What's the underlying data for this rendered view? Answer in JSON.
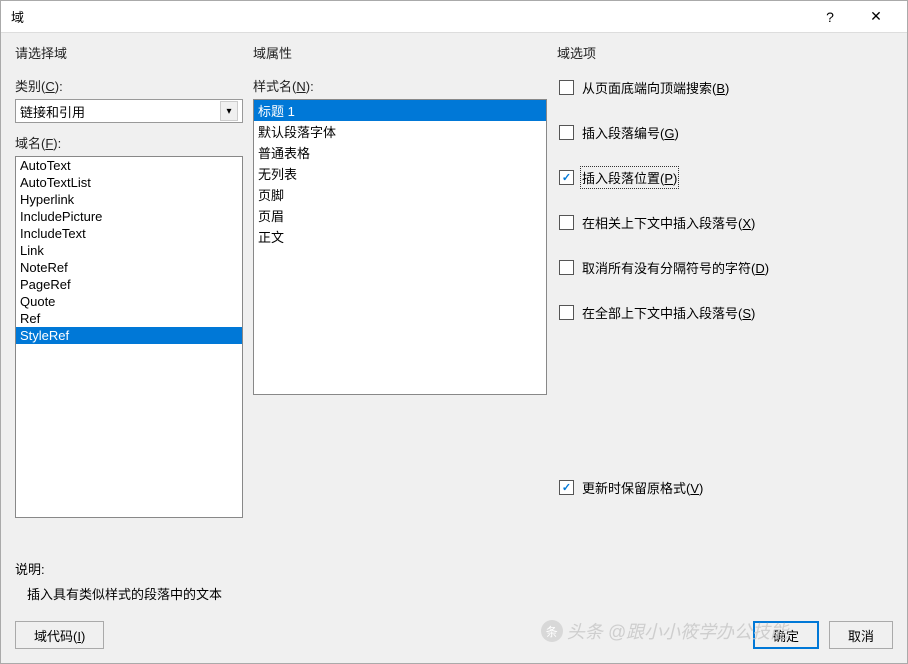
{
  "titlebar": {
    "title": "域",
    "help": "?",
    "close": "✕"
  },
  "col1": {
    "groupTitle": "请选择域",
    "categoryLabel": "类别(",
    "categoryKey": "C",
    "categoryLabelEnd": "):",
    "categoryValue": "链接和引用",
    "fieldNameLabel": "域名(",
    "fieldNameKey": "F",
    "fieldNameLabelEnd": "):",
    "items": [
      "AutoText",
      "AutoTextList",
      "Hyperlink",
      "IncludePicture",
      "IncludeText",
      "Link",
      "NoteRef",
      "PageRef",
      "Quote",
      "Ref",
      "StyleRef"
    ],
    "selectedIndex": 10
  },
  "col2": {
    "groupTitle": "域属性",
    "styleLabel": "样式名(",
    "styleKey": "N",
    "styleLabelEnd": "):",
    "items": [
      "标题 1",
      "默认段落字体",
      "普通表格",
      "无列表",
      "页脚",
      "页眉",
      "正文"
    ],
    "selectedIndex": 0
  },
  "col3": {
    "groupTitle": "域选项",
    "options": [
      {
        "label": "从页面底端向顶端搜索(",
        "key": "B",
        "end": ")",
        "checked": false
      },
      {
        "label": "插入段落编号(",
        "key": "G",
        "end": ")",
        "checked": false
      },
      {
        "label": "插入段落位置(",
        "key": "P",
        "end": ")",
        "checked": true,
        "focus": true
      },
      {
        "label": "在相关上下文中插入段落号(",
        "key": "X",
        "end": ")",
        "checked": false
      },
      {
        "label": "取消所有没有分隔符号的字符(",
        "key": "D",
        "end": ")",
        "checked": false
      },
      {
        "label": "在全部上下文中插入段落号(",
        "key": "S",
        "end": ")",
        "checked": false
      }
    ],
    "preserve": {
      "label": "更新时保留原格式(",
      "key": "V",
      "end": ")",
      "checked": true
    }
  },
  "explain": {
    "label": "说明:",
    "text": "插入具有类似样式的段落中的文本"
  },
  "footer": {
    "codeBtn": "域代码(",
    "codeKey": "I",
    "codeBtnEnd": ")",
    "okBtn": "确定",
    "cancelBtn": "取消"
  },
  "watermark": "头条 @跟小小筱学办公技能"
}
